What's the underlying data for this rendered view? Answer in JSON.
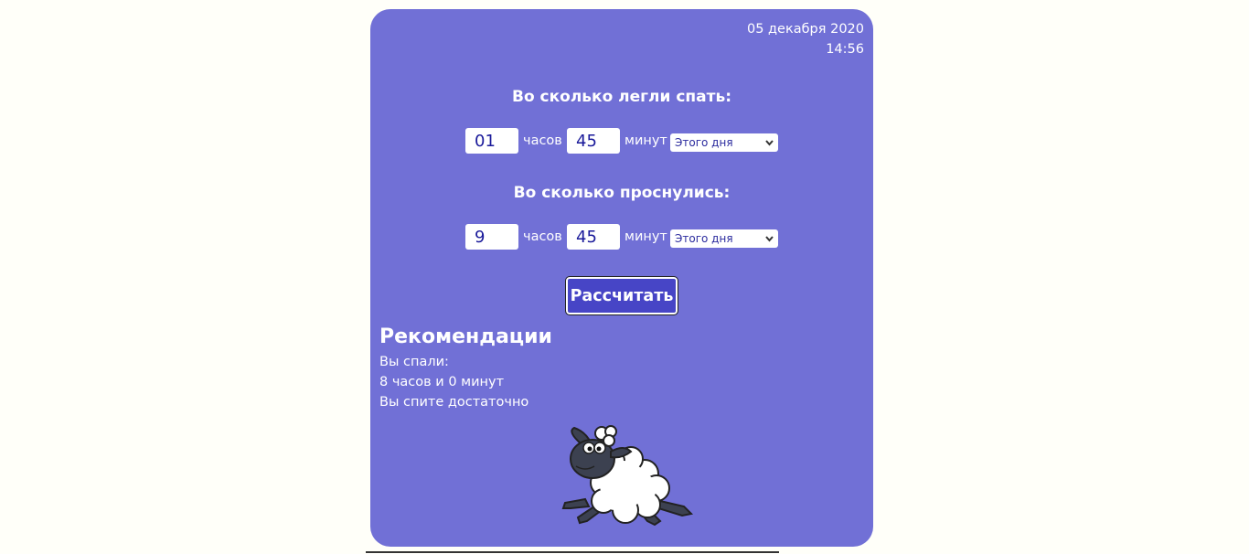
{
  "header": {
    "date": "05 декабря 2020",
    "time": "14:56"
  },
  "bedtime": {
    "heading": "Во сколько легли спать:",
    "hours_value": "01",
    "hours_label": "часов",
    "minutes_value": "45",
    "minutes_label": "минут",
    "day_selected": "Этого дня"
  },
  "wakeup": {
    "heading": "Во сколько проснулись:",
    "hours_value": "9",
    "hours_label": "часов",
    "minutes_value": "45",
    "minutes_label": "минут",
    "day_selected": "Этого дня"
  },
  "calculate_button": "Рассчитать",
  "recommendations": {
    "title": "Рекомендации",
    "slept_label": "Вы спали:",
    "slept_value": "8 часов и 0 минут",
    "verdict": "Вы спите достаточно"
  },
  "icons": {
    "select_arrow": "chevron-down-icon",
    "illustration": "sheep-illustration"
  },
  "colors": {
    "card_background": "#7170d6",
    "button_background": "#4745c6",
    "input_text": "#1a1a9a",
    "page_background": "#fffff9"
  }
}
